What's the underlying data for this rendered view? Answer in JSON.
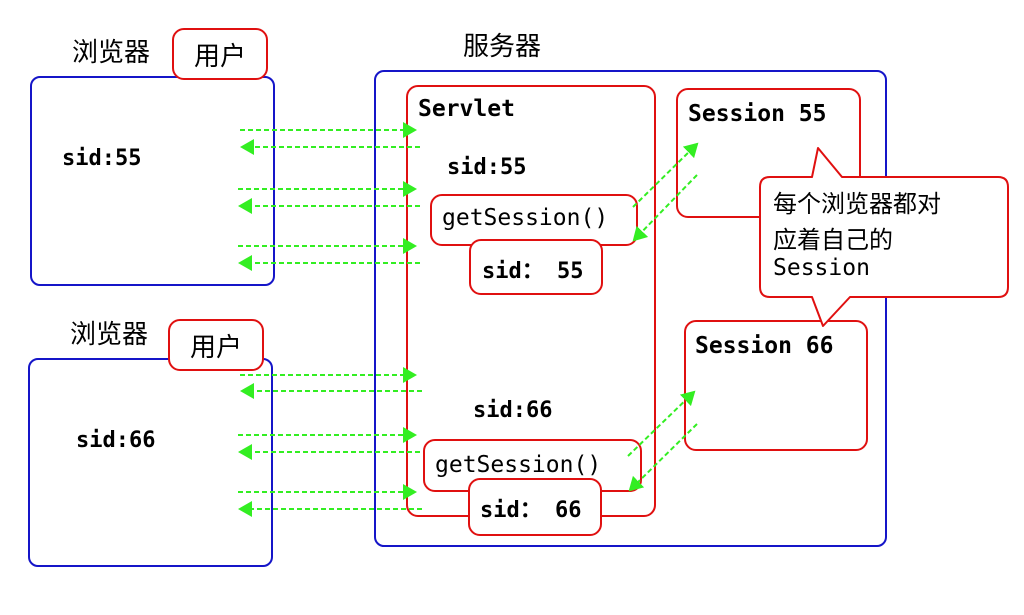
{
  "browser1": {
    "label": "浏览器",
    "user": "用户",
    "sid": "sid:55"
  },
  "browser2": {
    "label": "浏览器",
    "user": "用户",
    "sid": "sid:66"
  },
  "server": {
    "label": "服务器",
    "servlet_label": "Servlet",
    "request1": {
      "sid": "sid:55",
      "method": "getSession()",
      "result": "sid： 55"
    },
    "request2": {
      "sid": "sid:66",
      "method": "getSession()",
      "result": "sid： 66"
    },
    "session1": "Session 55",
    "session2": "Session 66"
  },
  "callout": {
    "line1": "每个浏览器都对",
    "line2": "应着自己的",
    "line3": "Session"
  },
  "colors": {
    "browser_border": "#1515c8",
    "box_border": "#e01010",
    "arrow": "#33ee22"
  }
}
